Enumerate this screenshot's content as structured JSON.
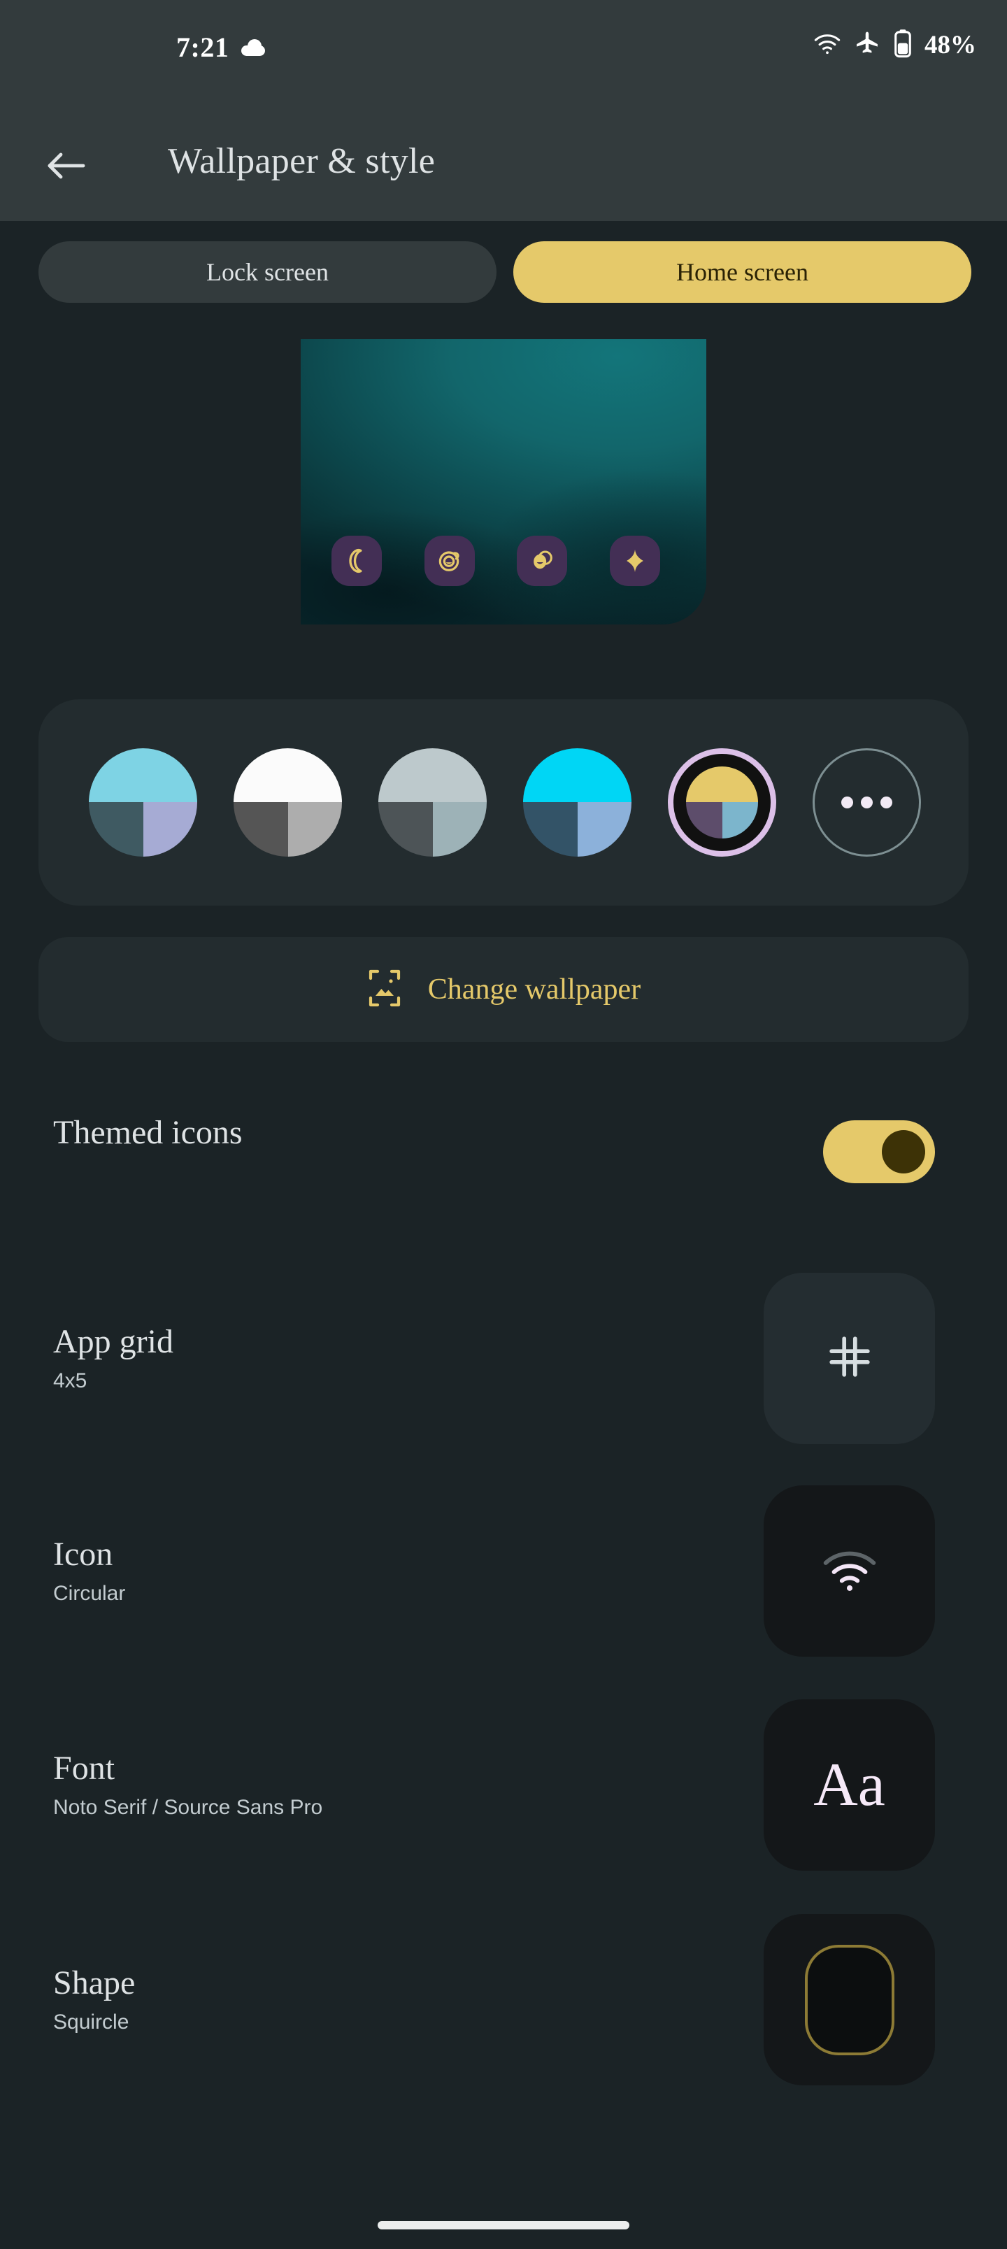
{
  "status_bar": {
    "time": "7:21",
    "weather_icon": "cloud-icon",
    "wifi_icon": "wifi-icon",
    "airplane_icon": "airplane-mode-icon",
    "battery_icon": "battery-icon",
    "battery_label": "48%"
  },
  "app_bar": {
    "back_icon": "back-arrow-icon",
    "title": "Wallpaper & style"
  },
  "tabs": [
    {
      "label": "Lock screen",
      "selected": false
    },
    {
      "label": "Home screen",
      "selected": true
    }
  ],
  "preview": {
    "name": "home-screen-wallpaper-preview",
    "dock_icons": [
      "phone-icon",
      "camera-icon",
      "contacts-icon",
      "assistant-sparkle-icon"
    ],
    "icon_background": "#432f55",
    "icon_foreground": "#e5c96a"
  },
  "colors": {
    "swatches": [
      {
        "name": "color-swatch-teal",
        "top": "#7ed3e4",
        "bottom_left": "#3f5a62",
        "bottom_right": "#a6abd4",
        "selected": false
      },
      {
        "name": "color-swatch-white",
        "top": "#fbfbfb",
        "bottom_left": "#555555",
        "bottom_right": "#adadad",
        "selected": false
      },
      {
        "name": "color-swatch-gray",
        "top": "#bdc9cc",
        "bottom_left": "#4d5457",
        "bottom_right": "#9db2b7",
        "selected": false
      },
      {
        "name": "color-swatch-cyan",
        "top": "#00d6f5",
        "bottom_left": "#335367",
        "bottom_right": "#8cb1da",
        "selected": false
      },
      {
        "name": "color-swatch-yellow",
        "top": "#e5c96a",
        "bottom_left": "#5d4d6b",
        "bottom_right": "#7cb5cc",
        "selected": true
      }
    ],
    "more_button": {
      "name": "more-colors-button",
      "icon": "ellipsis-icon"
    },
    "selection_ring_color": "#dcc0e8"
  },
  "change_wallpaper": {
    "icon": "wallpaper-image-icon",
    "label": "Change wallpaper",
    "accent": "#e5c96a"
  },
  "settings": [
    {
      "name": "themed-icons",
      "title": "Themed icons",
      "subtitle": "",
      "control": "toggle",
      "toggle_on": true,
      "toggle_color": "#e5c96a"
    },
    {
      "name": "app-grid",
      "title": "App grid",
      "subtitle": "4x5",
      "control": "thumbnail",
      "thumb_icon": "grid-hash-icon"
    },
    {
      "name": "icon",
      "title": "Icon",
      "subtitle": "Circular",
      "control": "thumbnail",
      "thumb_icon": "wifi-icon"
    },
    {
      "name": "font",
      "title": "Font",
      "subtitle": "Noto Serif / Source Sans Pro",
      "control": "thumbnail",
      "thumb_icon": "aa-text-icon",
      "thumb_text": "Aa"
    },
    {
      "name": "shape",
      "title": "Shape",
      "subtitle": "Squircle",
      "control": "thumbnail",
      "thumb_icon": "squircle-shape-icon"
    }
  ],
  "nav_bar": {
    "home_indicator": "home-gesture-pill"
  },
  "theme": {
    "background": "#1b2326",
    "surface": "#232c2f",
    "app_bar_background": "#333b3d",
    "accent": "#e5c96a",
    "text_primary": "#dfe3e5",
    "text_secondary": "#c3ccd0"
  }
}
